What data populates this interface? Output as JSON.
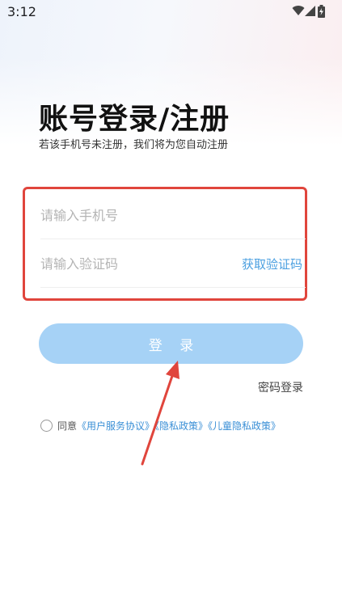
{
  "status_bar": {
    "time": "3:12",
    "icons": [
      "wifi-icon",
      "signal-icon",
      "battery-icon"
    ]
  },
  "header": {
    "title": "账号登录/注册",
    "subtitle": "若该手机号未注册，我们将为您自动注册"
  },
  "form": {
    "phone_placeholder": "请输入手机号",
    "code_placeholder": "请输入验证码",
    "get_code_label": "获取验证码"
  },
  "actions": {
    "login_label": "登 录",
    "password_login_label": "密码登录"
  },
  "agreement": {
    "prefix": "同意",
    "user_agreement": "《用户服务协议》",
    "privacy_policy": "《隐私政策》",
    "children_privacy": "《儿童隐私政策》"
  },
  "colors": {
    "accent": "#4a9fe0",
    "login_button": "#a6d2f6",
    "highlight_border": "#e0453c",
    "annotation_arrow": "#e0453c"
  }
}
